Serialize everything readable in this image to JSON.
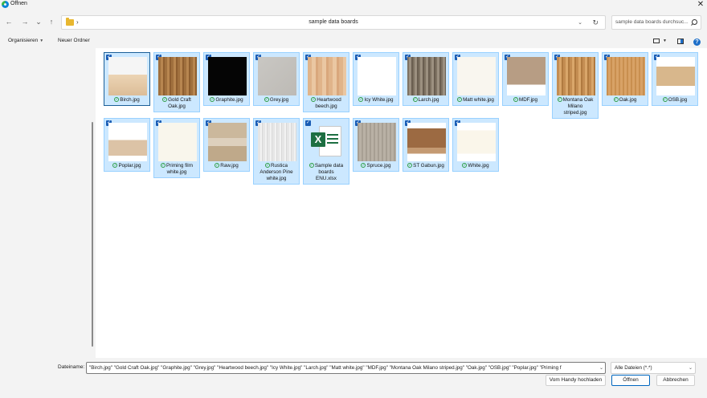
{
  "window": {
    "title": "Öffnen",
    "close_glyph": "✕"
  },
  "nav": {
    "back": "←",
    "forward": "→",
    "recent": "⌄",
    "up": "↑"
  },
  "address": {
    "chevron": "›",
    "path": "sample data boards",
    "dropdown": "⌄",
    "refresh": "↻"
  },
  "search": {
    "placeholder": "sample data boards durchsuc..."
  },
  "toolbar": {
    "organize": "Organisieren",
    "organize_caret": "▼",
    "new_folder": "Neuer Ordner",
    "view_caret": "▼",
    "help": "?"
  },
  "files": [
    {
      "name": "Birch.jpg",
      "lines": [
        "Birch.jpg"
      ],
      "thumb": "birch",
      "focused": true
    },
    {
      "name": "Gold Craft Oak.jpg",
      "lines": [
        "Gold Craft",
        "Oak.jpg"
      ],
      "thumb": "goldoak"
    },
    {
      "name": "Graphite.jpg",
      "lines": [
        "Graphite.jpg"
      ],
      "thumb": "graphite"
    },
    {
      "name": "Grey.jpg",
      "lines": [
        "Grey.jpg"
      ],
      "thumb": "grey"
    },
    {
      "name": "Heartwood beech.jpg",
      "lines": [
        "Heartwood",
        "beech.jpg"
      ],
      "thumb": "beech"
    },
    {
      "name": "Icy White.jpg",
      "lines": [
        "Icy White.jpg"
      ],
      "thumb": "icywhite"
    },
    {
      "name": "Larch.jpg",
      "lines": [
        "Larch.jpg"
      ],
      "thumb": "larch"
    },
    {
      "name": "Matt white.jpg",
      "lines": [
        "Matt white.jpg"
      ],
      "thumb": "mattwhite"
    },
    {
      "name": "MDF.jpg",
      "lines": [
        "MDF.jpg"
      ],
      "thumb": "mdf"
    },
    {
      "name": "Montana Oak Milano striped.jpg",
      "lines": [
        "Montana Oak",
        "Milano",
        "striped.jpg"
      ],
      "thumb": "montana"
    },
    {
      "name": "Oak.jpg",
      "lines": [
        "Oak.jpg"
      ],
      "thumb": "oak"
    },
    {
      "name": "OSB.jpg",
      "lines": [
        "OSB.jpg"
      ],
      "thumb": "osb"
    },
    {
      "name": "Poplar.jpg",
      "lines": [
        "Poplar.jpg"
      ],
      "thumb": "poplar"
    },
    {
      "name": "Priming film white.jpg",
      "lines": [
        "Priming film",
        "white.jpg"
      ],
      "thumb": "priming"
    },
    {
      "name": "Raw.jpg",
      "lines": [
        "Raw.jpg"
      ],
      "thumb": "raw"
    },
    {
      "name": "Rustica Anderson Pine white.jpg",
      "lines": [
        "Rustica",
        "Anderson Pine",
        "white.jpg"
      ],
      "thumb": "rustica"
    },
    {
      "name": "Sample data boards ENU.xlsx",
      "lines": [
        "Sample data",
        "boards",
        "ENU.xlsx"
      ],
      "thumb": "excel"
    },
    {
      "name": "Spruce.jpg",
      "lines": [
        "Spruce.jpg"
      ],
      "thumb": "spruce"
    },
    {
      "name": "ST Gabun.jpg",
      "lines": [
        "ST Gabun.jpg"
      ],
      "thumb": "gabun"
    },
    {
      "name": "White.jpg",
      "lines": [
        "White.jpg"
      ],
      "thumb": "white"
    }
  ],
  "bottom": {
    "filename_label": "Dateiname:",
    "filename_value": "\"Birch.jpg\" \"Gold Craft Oak.jpg\" \"Graphite.jpg\" \"Grey.jpg\" \"Heartwood beech.jpg\" \"Icy White.jpg\" \"Larch.jpg\" \"Matt white.jpg\" \"MDF.jpg\" \"Montana Oak Milano striped.jpg\" \"Oak.jpg\" \"OSB.jpg\" \"Poplar.jpg\" \"Priming f",
    "filetype": "Alle Dateien (*.*)",
    "caret": "⌄",
    "phone_button": "Vom Handy hochladen",
    "open_button": "Öffnen",
    "cancel_button": "Abbrechen"
  }
}
